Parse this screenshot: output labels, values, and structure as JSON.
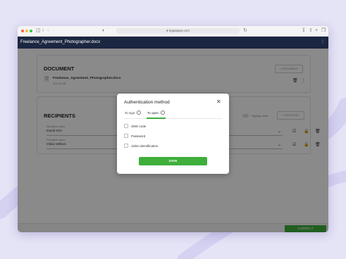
{
  "browser": {
    "url": "● legalapps.com"
  },
  "app": {
    "file_name": "Freelance_Agreement_Photographer.docx",
    "menu_icon": "dots-icon"
  },
  "document": {
    "heading": "DOCUMENT",
    "add_button": "+ DOCUMENT",
    "doc_name": "Freelance_Agreement_Photographer.docx",
    "doc_size": "104.16 KB"
  },
  "recipients": {
    "heading": "RECIPIENTS",
    "signing_order_label": "Signing order",
    "add_button": "+ RECIPIENT",
    "rows": [
      {
        "label": "Recipient name",
        "value": "David Kim"
      },
      {
        "label": "Recipient name",
        "value": "Olivia Wilson"
      }
    ]
  },
  "footer": {
    "correct_button": "CORRECT"
  },
  "modal": {
    "title": "Authentication method",
    "tabs": [
      {
        "label": "To sign"
      },
      {
        "label": "To open"
      }
    ],
    "active_tab": "To open",
    "options": [
      {
        "label": "SMS code"
      },
      {
        "label": "Password"
      },
      {
        "label": "Video identification"
      }
    ],
    "save_button": "SAVE"
  },
  "colors": {
    "background": "#e5e3f6",
    "app_bar": "#1b2640",
    "accent_green": "#3fae3b",
    "overlay": "rgba(0,0,0,0.46)"
  }
}
